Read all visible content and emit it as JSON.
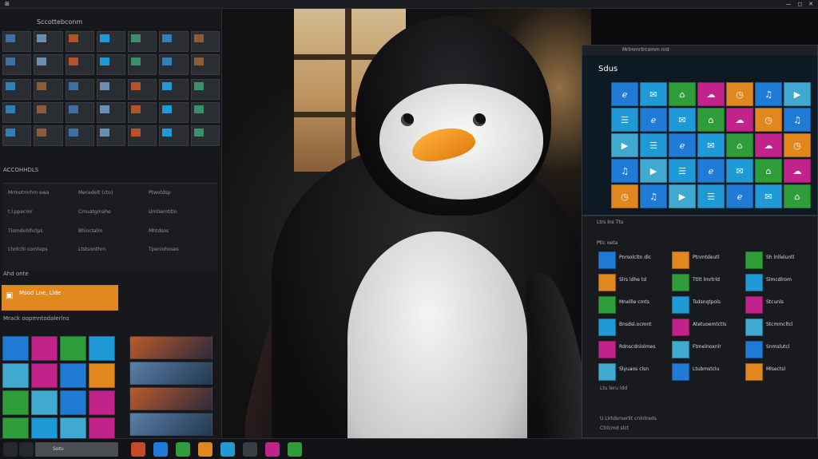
{
  "topbar": {
    "left_glyph": "⊞",
    "right_glyphs": [
      "—",
      "◻",
      "✕"
    ]
  },
  "left_panel": {
    "title": "Sccottebconm",
    "section_2": "ACCOHHDLS",
    "section_3": "Ahd onte",
    "section_4": "Mrack oopmntodalerlns",
    "orange_tile_label": "Msod Lne, Llde",
    "tree_items": [
      "Mrmotmrhm ewa",
      "Mecedelt (cto)",
      "Ptwotdsp",
      "t.l.ppecmr",
      "Cmuatgmahe",
      "Umtiemtitlo",
      "Tlomdohlhclps",
      "Bhinctalm",
      "Mhtdsos",
      "Lhotchl comteps",
      "Ltstsonthrn",
      "Tpeniohoses"
    ]
  },
  "taskbar": {
    "search_text": "Sotu"
  },
  "right_top": {
    "titlebar_text": "Mrlmmrtrcomm nrd",
    "heading": "Sdus"
  },
  "right_bottom": {
    "header_1": "Ltrs  lns  Ttu",
    "header_2": "Ptlc  oeta",
    "rows": [
      [
        "Pnrsolcltn dlc",
        "Ptnmtdeutl",
        "Sh lnlleluntl"
      ],
      [
        "Slrs ldhe td",
        "Ttllt lmrtrld",
        "Slmcdlrom"
      ],
      [
        "Mnellle cmts",
        "Tsdsnqtpols",
        "Stcunls"
      ],
      [
        "Bnsdsl.ocmnt",
        "Atetuoemtctls",
        "Stcmmcltcl"
      ],
      [
        "Rdnscdnlolmes",
        "Ftmelnoxnlr",
        "Snmslutcl"
      ],
      [
        "Slyuaos clsn",
        "Ltubmstclu",
        "Mlsectsl"
      ]
    ],
    "footer_1": "Ltu  leru  ldd",
    "footer_2": "U  Llrtdsrnerlit  cnlntreds",
    "footer_3": "Ctrlcmd slct"
  },
  "colors": {
    "accent_blue": "#1f7bd6",
    "accent_orange": "#e0871e",
    "accent_magenta": "#c2238a",
    "accent_green": "#2f9d3a"
  }
}
